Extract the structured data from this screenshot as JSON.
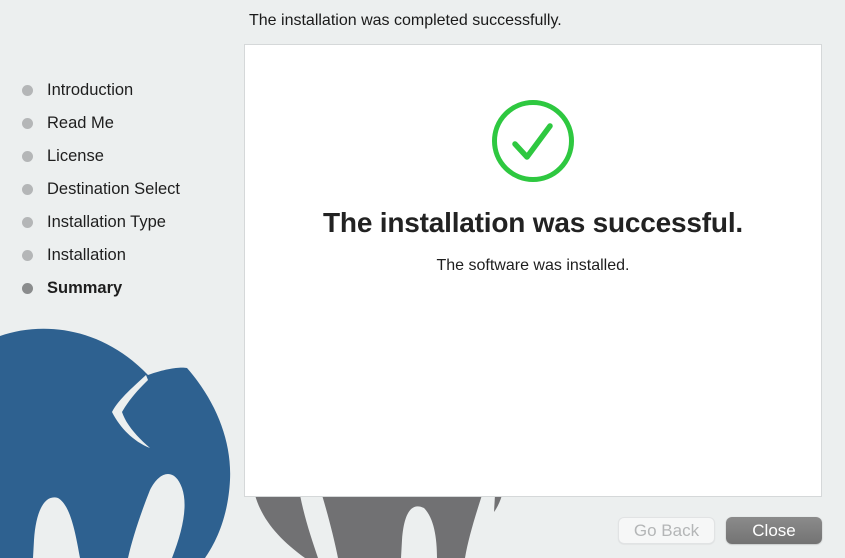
{
  "window": {
    "header_text": "The installation was completed successfully."
  },
  "sidebar": {
    "steps": [
      {
        "label": "Introduction",
        "current": false
      },
      {
        "label": "Read Me",
        "current": false
      },
      {
        "label": "License",
        "current": false
      },
      {
        "label": "Destination Select",
        "current": false
      },
      {
        "label": "Installation Type",
        "current": false
      },
      {
        "label": "Installation",
        "current": false
      },
      {
        "label": "Summary",
        "current": true
      }
    ]
  },
  "main": {
    "icon": "checkmark-circle-icon",
    "title": "The installation was successful.",
    "subtitle": "The software was installed."
  },
  "buttons": {
    "go_back": "Go Back",
    "close": "Close"
  },
  "colors": {
    "success_green": "#2ec840",
    "elephant_blue": "#2e6190",
    "elephant_gray": "#717173",
    "background": "#ecefef"
  }
}
